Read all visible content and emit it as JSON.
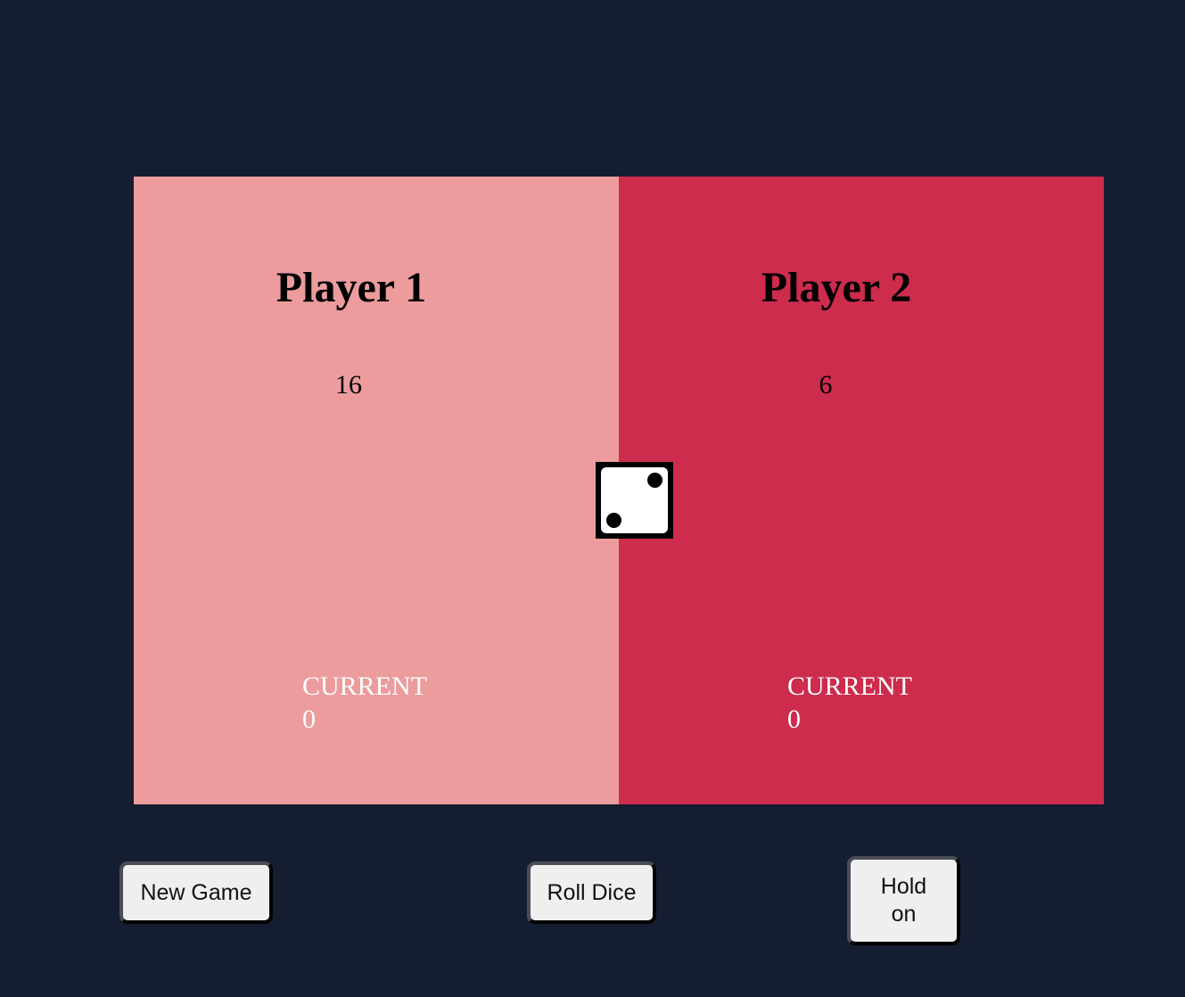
{
  "players": [
    {
      "name": "Player 1",
      "score": "16",
      "current_label": "CURRENT",
      "current_value": "0",
      "color": "#ec9c9d"
    },
    {
      "name": "Player 2",
      "score": "6",
      "current_label": "CURRENT",
      "current_value": "0",
      "color": "#cd2c4d"
    }
  ],
  "dice": {
    "value": 2,
    "icon": "dice-two-icon"
  },
  "buttons": {
    "new_game": "New Game",
    "roll_dice": "Roll Dice",
    "hold": "Hold on"
  },
  "colors": {
    "background": "#151d30",
    "player_1_panel": "#ec9c9d",
    "player_2_panel": "#cd2c4d"
  }
}
